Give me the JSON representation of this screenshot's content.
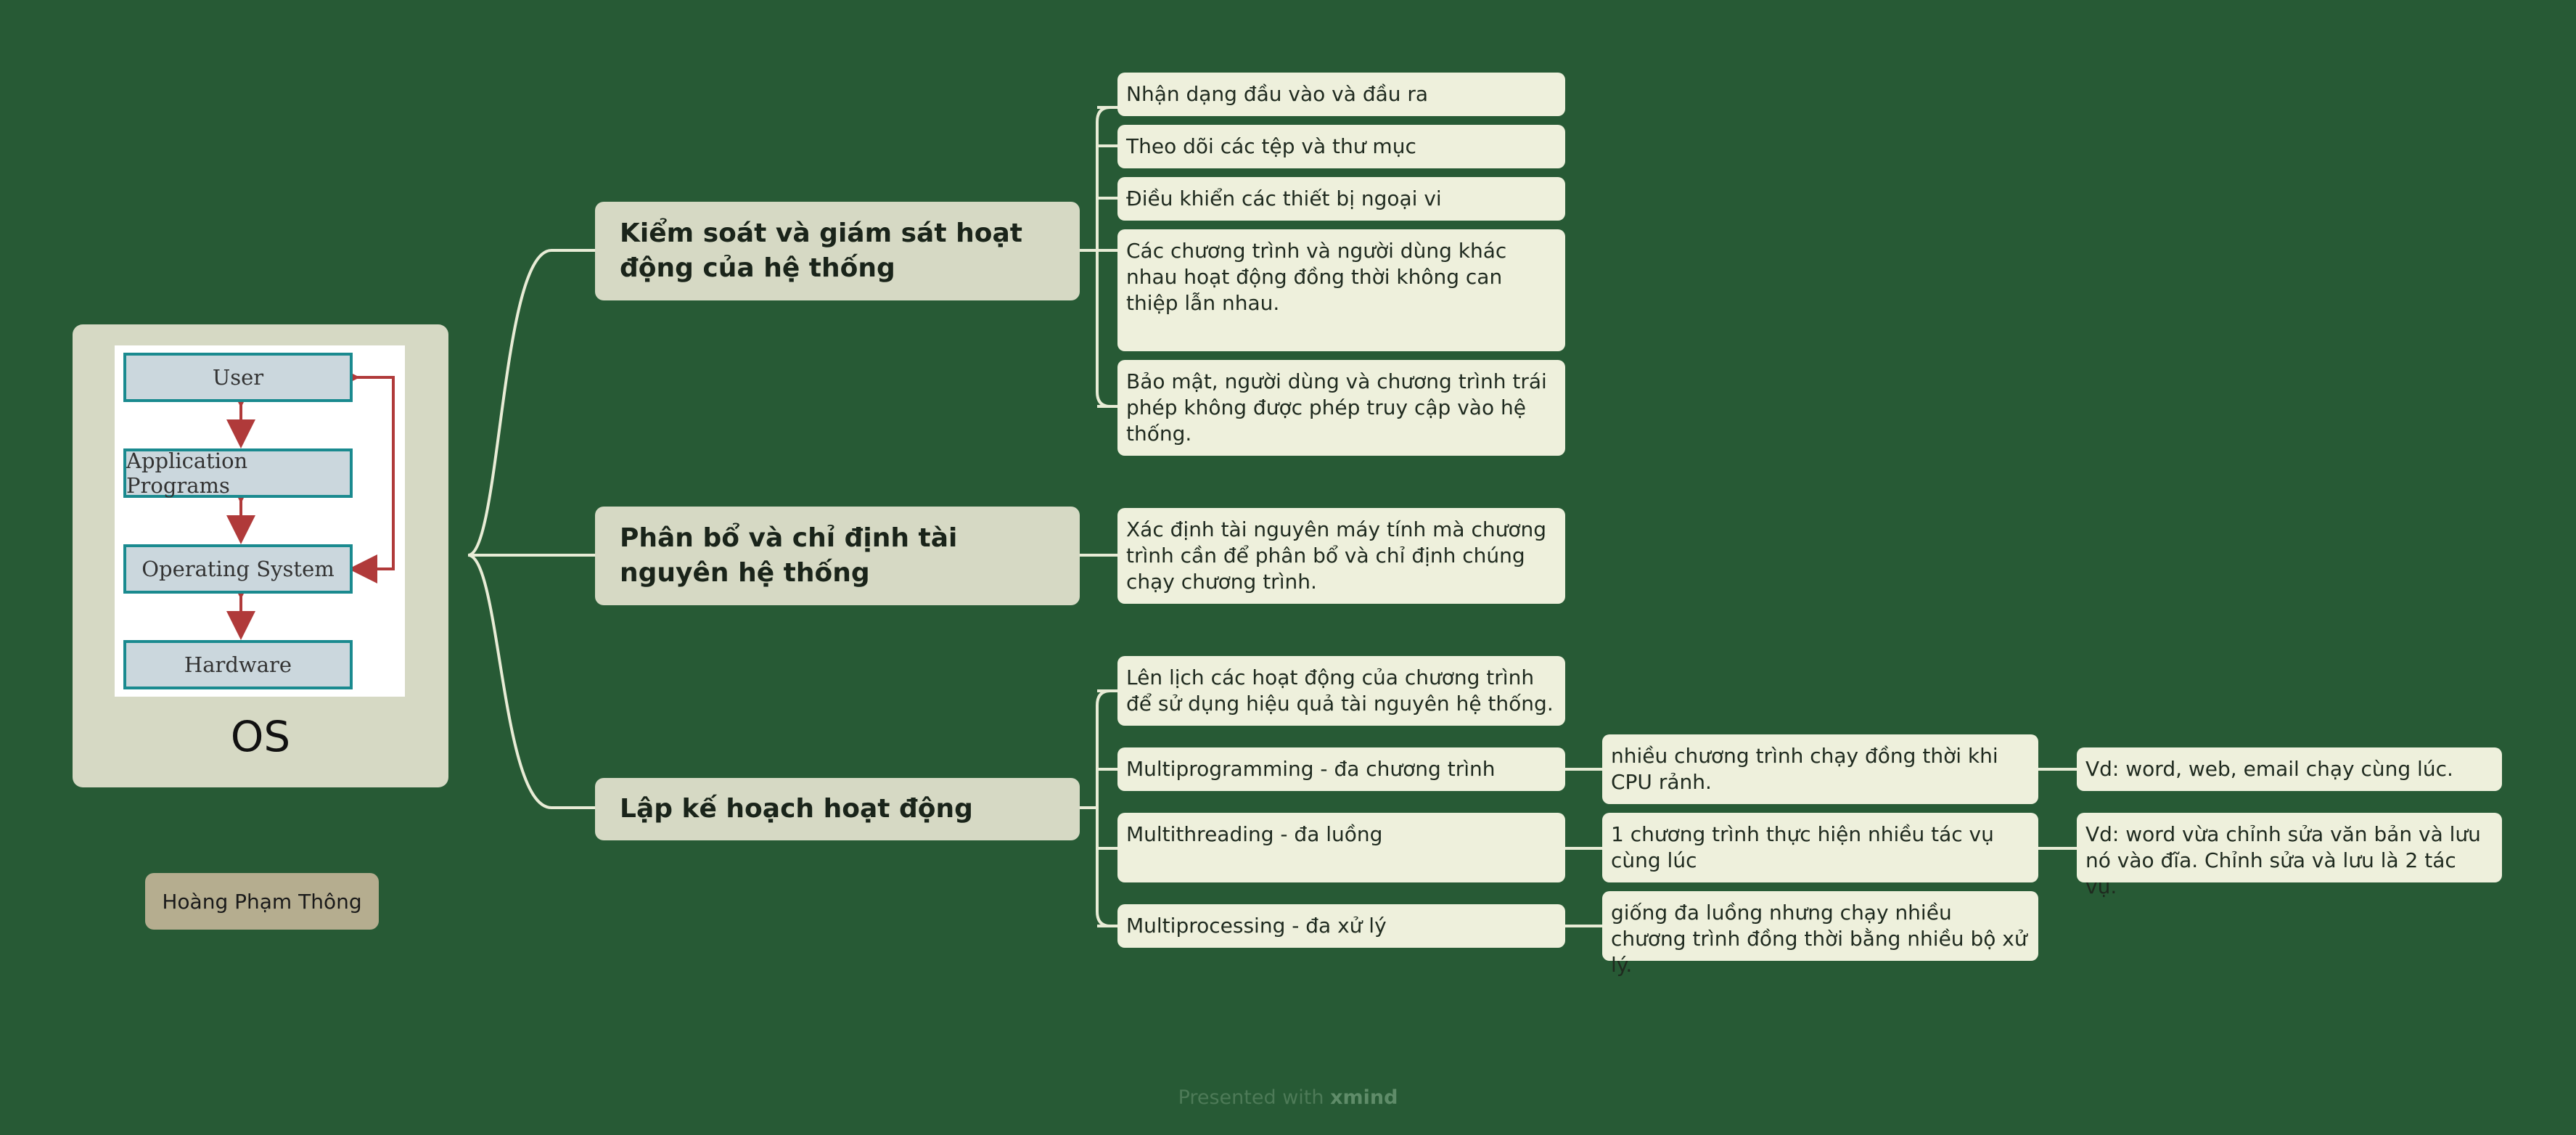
{
  "root": {
    "title": "OS",
    "diagram": {
      "boxes": [
        "User",
        "Application Programs",
        "Operating System",
        "Hardware"
      ]
    }
  },
  "branches": [
    {
      "label": "Kiểm soát và giám sát hoạt động của hệ thống",
      "children": [
        "Nhận dạng đầu vào và đầu ra",
        "Theo dõi các tệp và thư mục",
        "Điều khiển các thiết bị ngoại vi",
        "Các chương trình và người dùng khác nhau hoạt động đồng thời không can thiệp lẫn nhau.",
        "Bảo mật, người dùng và chương trình trái phép không được phép truy cập vào hệ thống."
      ]
    },
    {
      "label": "Phân bổ và chỉ định tài nguyên hệ thống",
      "children": [
        "Xác định tài nguyên máy tính mà chương trình cần để phân bổ và chỉ định chúng chạy chương trình."
      ]
    },
    {
      "label": "Lập kế hoạch hoạt động",
      "children": [
        "Lên lịch các hoạt động của chương trình để sử dụng hiệu quả tài nguyên hệ thống.",
        "Multiprogramming - đa chương trình",
        "Multithreading - đa luồng",
        "Multiprocessing - đa xử lý"
      ],
      "details": [
        "nhiều chương trình chạy đồng thời khi CPU rảnh.",
        "1 chương trình thực hiện nhiều tác vụ cùng lúc",
        "giống đa luồng nhưng chạy nhiều chương trình đồng thời bằng nhiều bộ xử lý."
      ],
      "examples": [
        "Vd: word, web, email chạy cùng lúc.",
        "Vd: word vừa chỉnh sửa văn bản và lưu nó vào đĩa. Chỉnh sửa và lưu là 2 tác vụ."
      ]
    }
  ],
  "author": "Hoàng Phạm Thông",
  "footer": {
    "prefix": "Presented with",
    "brand": "xmind"
  },
  "colors": {
    "background": "#275a35",
    "main_node": "#d6d9c4",
    "leaf_node": "#eef0dc",
    "author_node": "#b5ad8f",
    "connector": "#e8ecd6",
    "diagram_box_border": "#1a8a8f",
    "diagram_arrow": "#b03a3a"
  }
}
